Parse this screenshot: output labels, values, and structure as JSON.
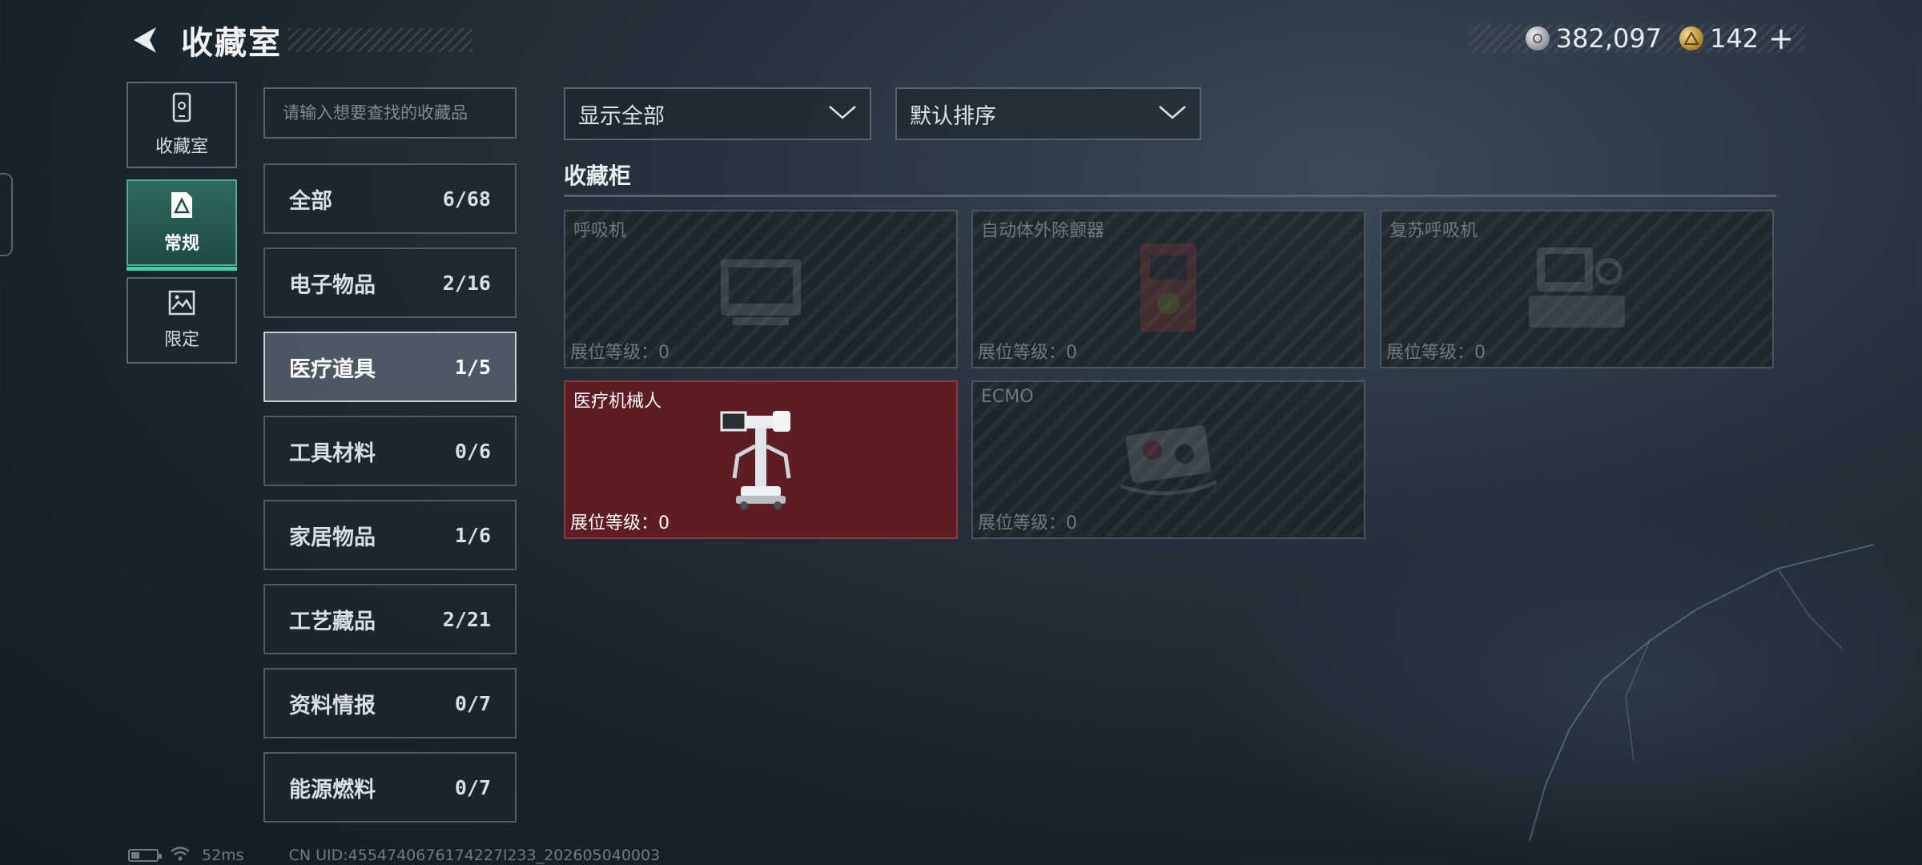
{
  "header": {
    "title": "收藏室",
    "currency": {
      "silver_value": "382,097",
      "gold_value": "142",
      "add_label": "+"
    }
  },
  "side_nav": [
    {
      "label": "收藏室",
      "icon": "phone-icon"
    },
    {
      "label": "常规",
      "icon": "triangle-card-icon",
      "active": true
    },
    {
      "label": "限定",
      "icon": "landscape-icon"
    }
  ],
  "search": {
    "placeholder": "请输入想要查找的收藏品"
  },
  "categories": [
    {
      "name": "全部",
      "count": "6/68"
    },
    {
      "name": "电子物品",
      "count": "2/16"
    },
    {
      "name": "医疗道具",
      "count": "1/5",
      "active": true
    },
    {
      "name": "工具材料",
      "count": "0/6"
    },
    {
      "name": "家居物品",
      "count": "1/6"
    },
    {
      "name": "工艺藏品",
      "count": "2/21"
    },
    {
      "name": "资料情报",
      "count": "0/7"
    },
    {
      "name": "能源燃料",
      "count": "0/7"
    }
  ],
  "filters": {
    "display": "显示全部",
    "sort": "默认排序"
  },
  "section_title": "收藏柜",
  "items": [
    {
      "name": "呼吸机",
      "level": "展位等级：0",
      "owned": false,
      "icon": "ventilator-icon"
    },
    {
      "name": "自动体外除颤器",
      "level": "展位等级：0",
      "owned": false,
      "icon": "defibrillator-icon"
    },
    {
      "name": "复苏呼吸机",
      "level": "展位等级：0",
      "owned": false,
      "icon": "resuscitator-icon"
    },
    {
      "name": "医疗机械人",
      "level": "展位等级：0",
      "owned": true,
      "icon": "medical-robot-icon"
    },
    {
      "name": "ECMO",
      "level": "展位等级：0",
      "owned": false,
      "icon": "ecmo-icon"
    }
  ],
  "footer": {
    "ping": "52ms",
    "uid": "CN UID:4554740676174227l233_202605040003"
  },
  "colors": {
    "accent": "#37d3a1",
    "owned_card": "#5d1d22"
  }
}
